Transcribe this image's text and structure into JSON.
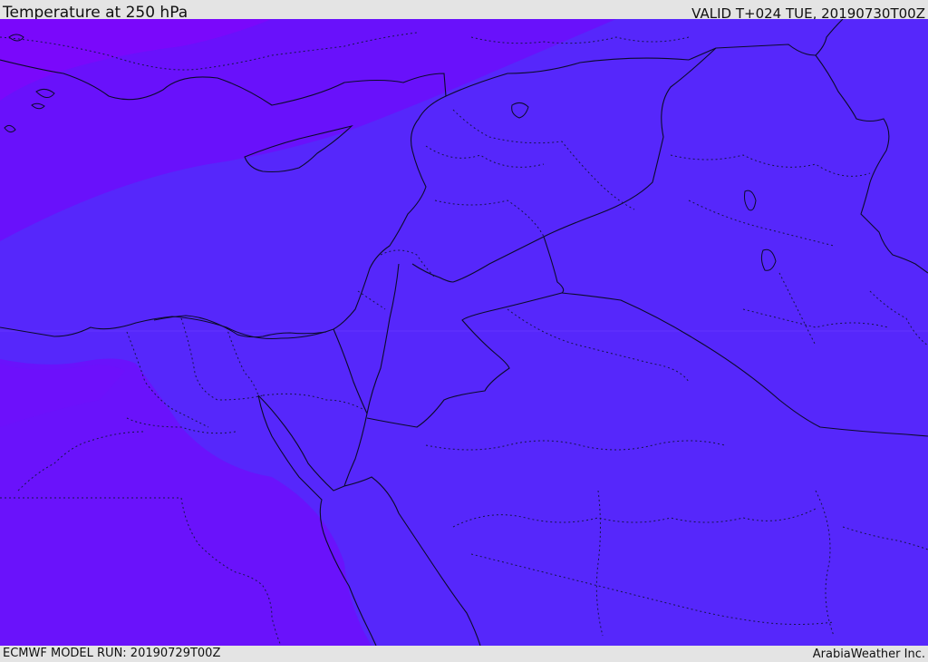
{
  "header": {
    "title": "Temperature at 250 hPa",
    "valid": "VALID T+024 TUE, 20190730T00Z"
  },
  "footer": {
    "model_run": "ECMWF MODEL RUN: 20190729T00Z",
    "credit": "ArabiaWeather Inc."
  },
  "map": {
    "colors": {
      "background_band": "#5627fb",
      "cold_band_dark": "#7a08fb",
      "cold_band_mid": "#6a12fb",
      "coastline": "#0b0b2a",
      "border_dotted": "#15154a"
    }
  }
}
